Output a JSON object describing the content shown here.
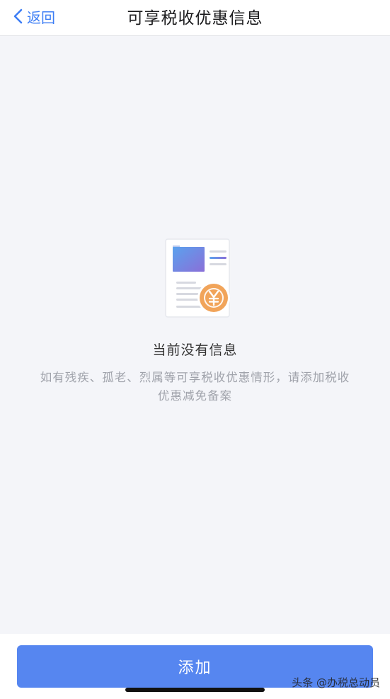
{
  "nav": {
    "back_label": "返回",
    "title": "可享税收优惠信息"
  },
  "empty_state": {
    "illustration": "document-coin-icon",
    "title": "当前没有信息",
    "description": "如有残疾、孤老、烈属等可享税收优惠情形，请添加税收优惠减免备案"
  },
  "footer": {
    "add_label": "添加",
    "watermark": "头条 @办税总动员"
  },
  "colors": {
    "accent": "#5686f0",
    "link": "#3d7ef5",
    "background": "#f4f5f9"
  }
}
